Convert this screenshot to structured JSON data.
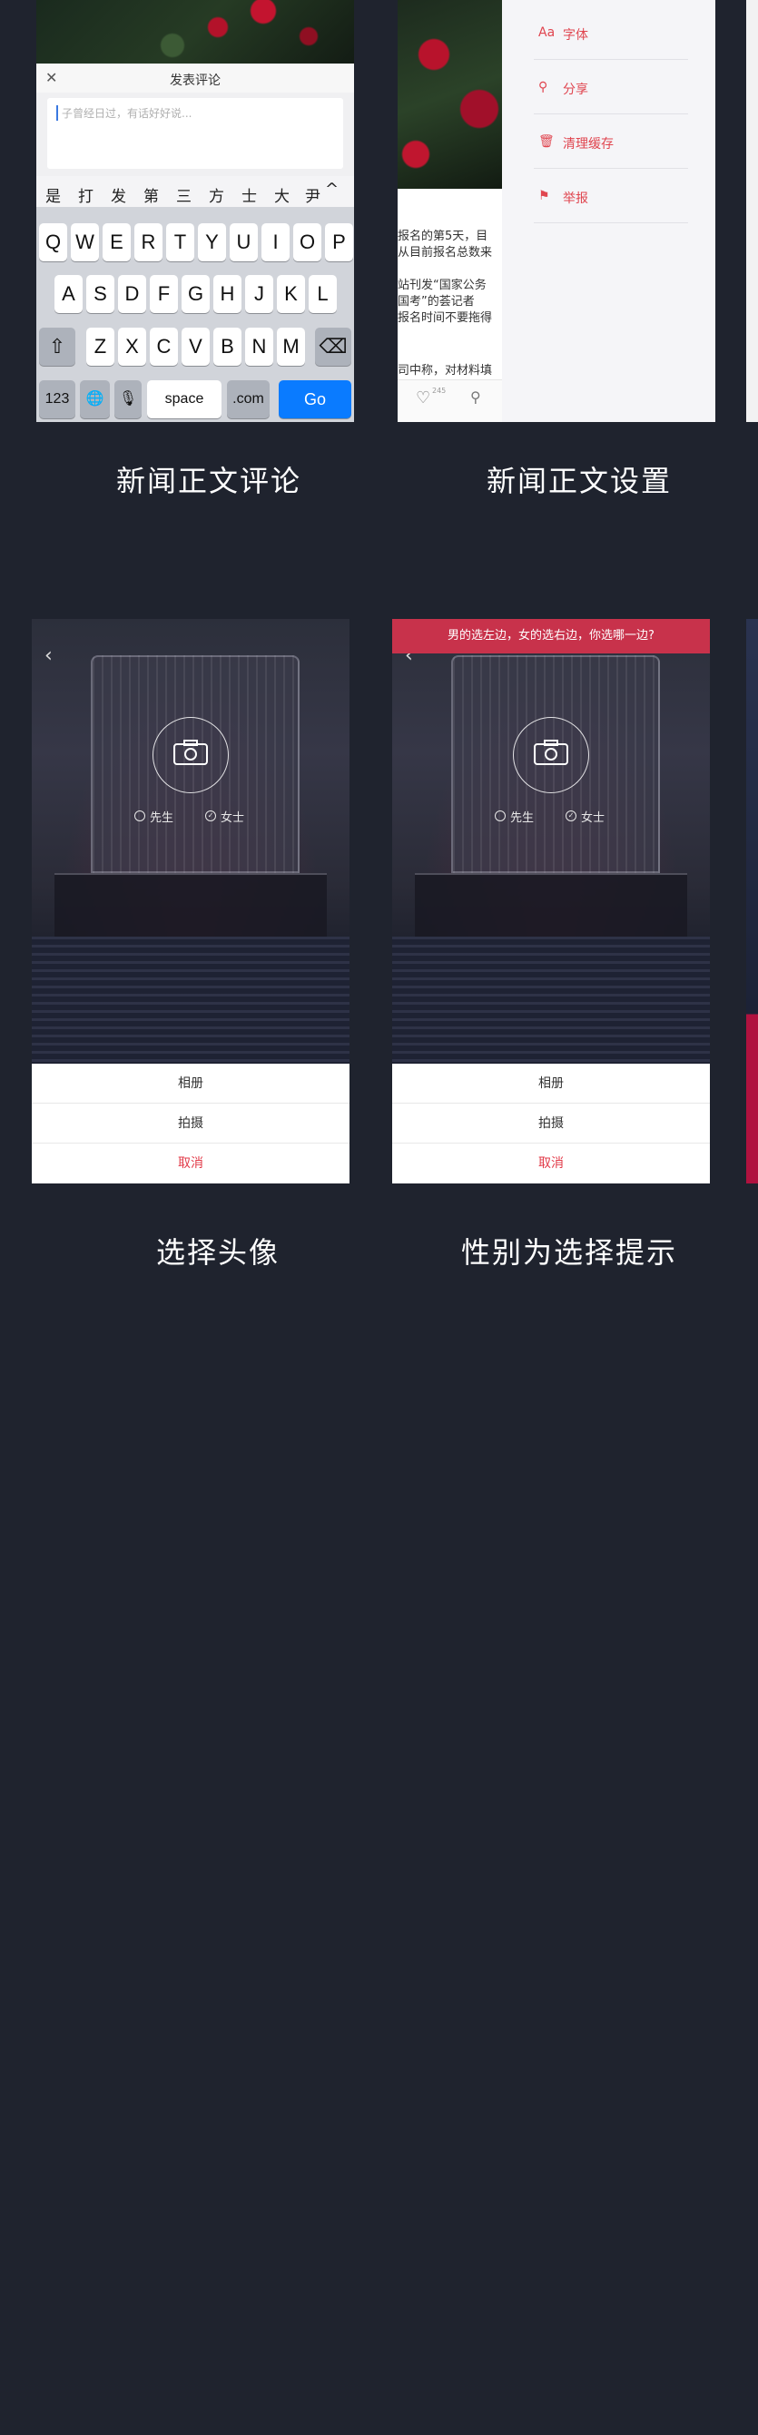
{
  "screens": [
    {
      "caption": "新闻正文评论",
      "header_title": "发表评论",
      "close_icon": "✕",
      "comment_placeholder": "子曾经日过，有话好好说...",
      "candidates": [
        "是",
        "打",
        "发",
        "第",
        "三",
        "方",
        "士",
        "大",
        "尹"
      ],
      "keyboard": {
        "row1": [
          "Q",
          "W",
          "E",
          "R",
          "T",
          "Y",
          "U",
          "I",
          "O",
          "P"
        ],
        "row2": [
          "A",
          "S",
          "D",
          "F",
          "G",
          "H",
          "J",
          "K",
          "L"
        ],
        "row3": [
          "Z",
          "X",
          "C",
          "V",
          "B",
          "N",
          "M"
        ],
        "shift_icon": "⇧",
        "delete_icon": "⌫",
        "num_key": "123",
        "globe_icon": "🌐",
        "mic_icon": "🎙",
        "space_label": "space",
        "dotcom_label": ".com",
        "go_label": "Go",
        "collapse_icon": "^"
      }
    },
    {
      "caption": "新闻正文设置",
      "article_lines": [
        "报名的第5天，目",
        "从目前报名总数来",
        "",
        "站刊发“国家公务",
        "国考”的荟记者",
        "报名时间不要拖得",
        "",
        "司中称，对材料填"
      ],
      "like_icon": "♡",
      "like_count": "245",
      "share_icon": "⚲",
      "menu": [
        {
          "icon": "Aa",
          "label": "字体"
        },
        {
          "icon": "⚲",
          "label": "分享"
        },
        {
          "icon": "🗑",
          "label": "清理缓存"
        },
        {
          "icon": "⚑",
          "label": "举报"
        }
      ]
    },
    {
      "caption": "选择头像",
      "back_icon": "‹",
      "camera_icon": "camera",
      "gender_options": [
        "先生",
        "女士"
      ],
      "sheet_buttons": [
        "相册",
        "拍摄",
        "取消"
      ]
    },
    {
      "caption": "性别为选择提示",
      "hint": "男的选左边，女的选右边，你选哪一边?",
      "back_icon": "‹",
      "camera_icon": "camera",
      "gender_options": [
        "先生",
        "女士"
      ],
      "sheet_buttons": [
        "相册",
        "拍摄",
        "取消"
      ]
    }
  ],
  "colors": {
    "background": "#1f232e",
    "accent_red": "#e0454f",
    "go_blue": "#0a7bff",
    "hint_red": "#c8324b"
  }
}
